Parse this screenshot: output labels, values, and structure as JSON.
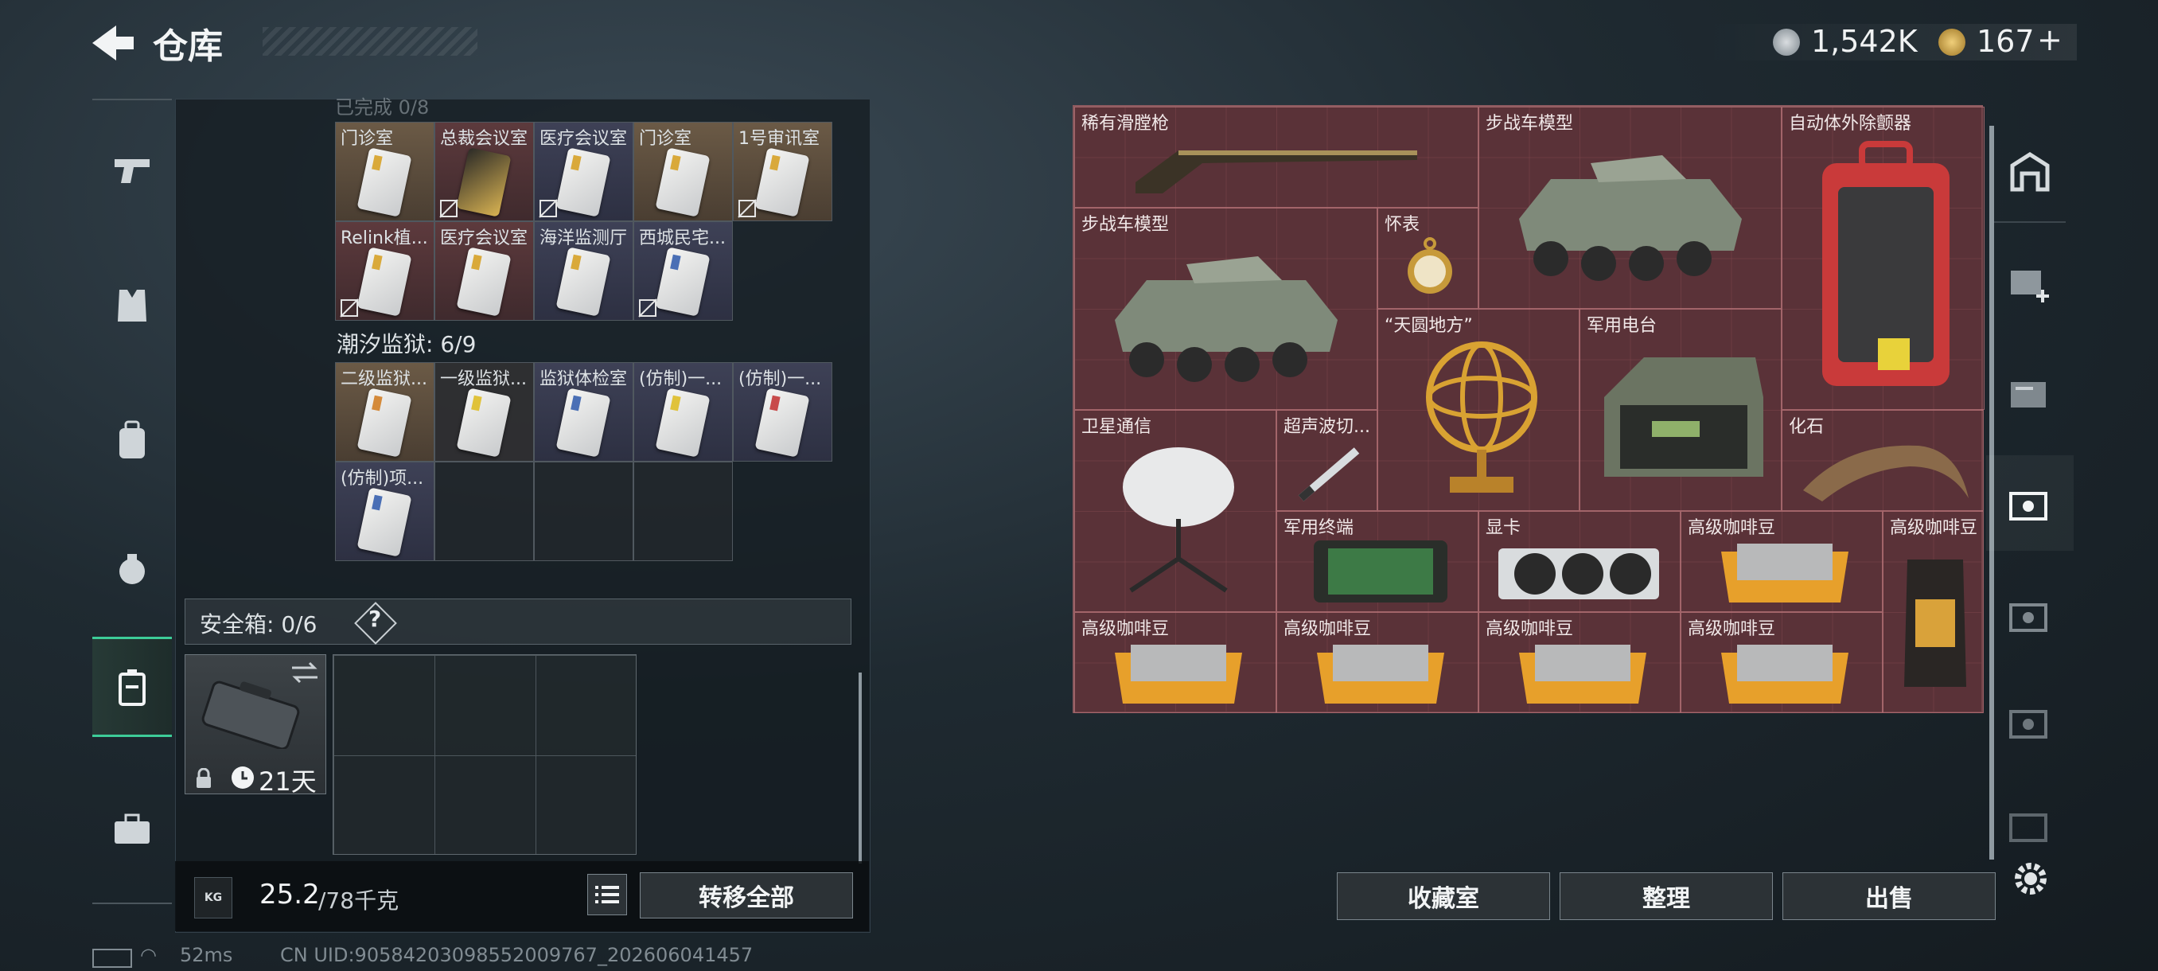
{
  "header": {
    "title": "仓库"
  },
  "currency": {
    "silver": "1,542K",
    "gold": "167",
    "gold_plus": "+"
  },
  "left_panel": {
    "cut_label": "已完成 0/8",
    "row1": [
      "门诊室",
      "总裁会议室",
      "医疗会议室",
      "门诊室",
      "1号审讯室"
    ],
    "row2": [
      "Relink植...",
      "医疗会议室",
      "海洋监测厅",
      "西城民宅..."
    ],
    "prison_section": "潮汐监狱: 6/9",
    "row3": [
      "二级监狱...",
      "一级监狱...",
      "监狱体检室",
      "(仿制)一...",
      "(仿制)一..."
    ],
    "row4": [
      "(仿制)项..."
    ],
    "safe_box": {
      "label": "安全箱: 0/6",
      "help": "?"
    },
    "case": {
      "duration": "21天"
    },
    "weight": {
      "current": "25.2",
      "max": "/78千克",
      "kg_badge": "KG"
    },
    "transfer_all": "转移全部"
  },
  "stash": {
    "items": {
      "musket": "稀有滑膛枪",
      "ifv1": "步战车模型",
      "aed": "自动体外除颤器",
      "ifv2": "步战车模型",
      "pocket_watch": "怀表",
      "armillary": "“天圆地方”",
      "radio": "军用电台",
      "satcom": "卫星通信",
      "ultrasonic": "超声波切...",
      "fossil": "化石",
      "terminal": "军用终端",
      "gpu": "显卡",
      "coffee1": "高级咖啡豆",
      "coffee_tall": "高级咖啡豆",
      "coffee2": "高级咖啡豆",
      "coffee3": "高级咖啡豆",
      "coffee4": "高级咖啡豆",
      "coffee5": "高级咖啡豆"
    }
  },
  "bottom_buttons": {
    "collection": "收藏室",
    "sort": "整理",
    "sell": "出售"
  },
  "status": {
    "ping": "52ms",
    "uid": "CN UID:9058420309855200976​7_202606041457"
  },
  "colors": {
    "accent_green": "#3dcc98",
    "stash_bg": "#4e2f35"
  }
}
